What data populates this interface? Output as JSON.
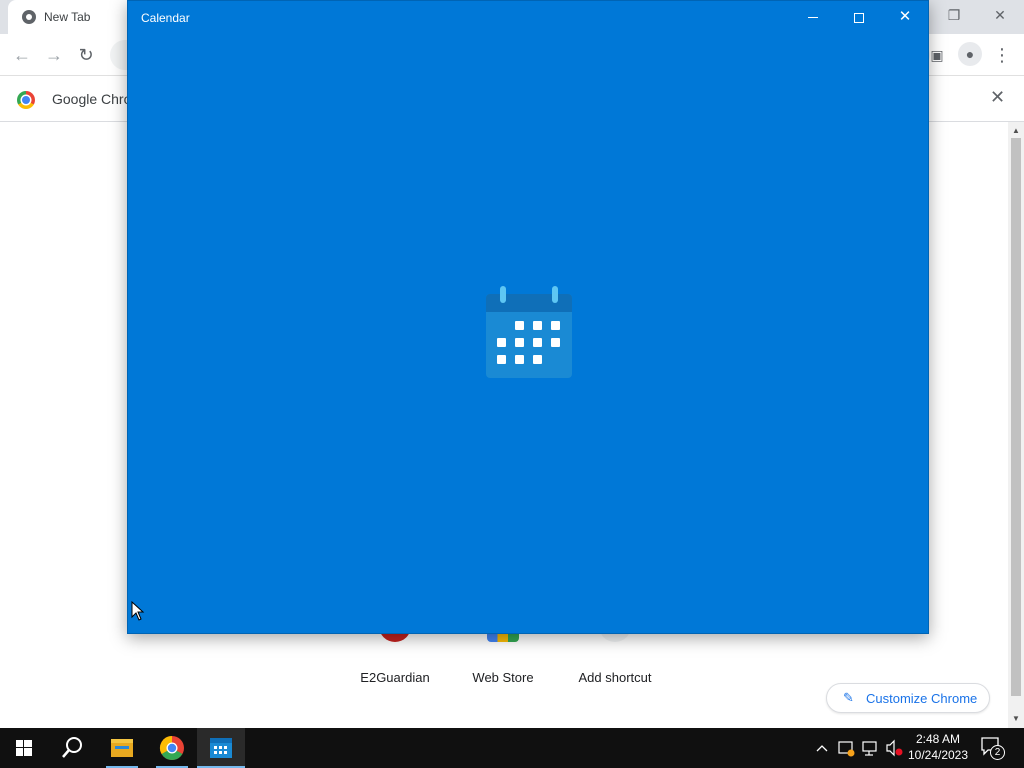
{
  "chrome": {
    "tab_title": "New Tab",
    "infobar_message": "Google Chrome",
    "shortcuts": [
      {
        "label": "E2Guardian"
      },
      {
        "label": "Web Store"
      },
      {
        "label": "Add shortcut"
      }
    ],
    "customize_label": "Customize Chrome"
  },
  "calendar_window": {
    "title": "Calendar",
    "background": "#0078d7"
  },
  "taskbar": {
    "time": "2:48 AM",
    "date": "10/24/2023",
    "notification_count": "2",
    "pinned": [
      {
        "icon": "windows-start-icon"
      },
      {
        "icon": "search-icon"
      },
      {
        "icon": "file-explorer-icon"
      },
      {
        "icon": "chrome-icon"
      },
      {
        "icon": "calendar-icon",
        "active": true
      }
    ]
  }
}
